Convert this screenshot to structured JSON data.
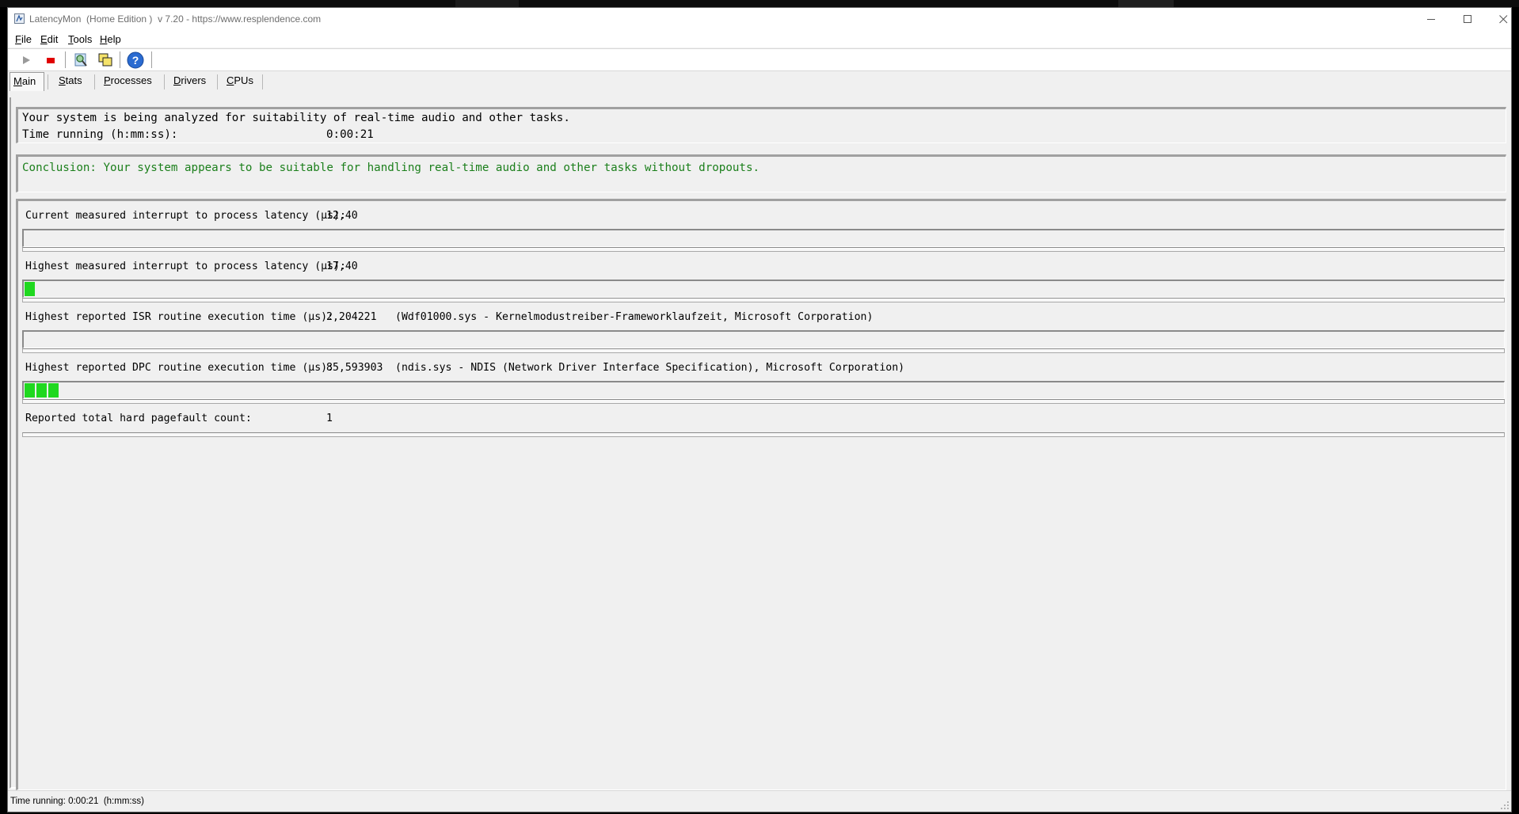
{
  "window": {
    "title": "LatencyMon  (Home Edition )  v 7.20 - https://www.resplendence.com"
  },
  "menu": {
    "file": {
      "accel": "F",
      "rest": "ile"
    },
    "edit": {
      "accel": "E",
      "rest": "dit"
    },
    "tools": {
      "accel": "T",
      "rest": "ools"
    },
    "help": {
      "accel": "H",
      "rest": "elp"
    }
  },
  "toolbar": {
    "icons": [
      "play-icon",
      "stop-icon",
      "search-drivers-icon",
      "windows-icon",
      "help-icon"
    ]
  },
  "tabs": [
    {
      "accel": "M",
      "rest": "ain"
    },
    {
      "accel": "S",
      "rest": "tats"
    },
    {
      "accel": "P",
      "rest": "rocesses"
    },
    {
      "accel": "D",
      "rest": "rivers"
    },
    {
      "accel": "C",
      "rest": "PUs"
    }
  ],
  "main": {
    "status_line": "Your system is being analyzed for suitability of real-time audio and other tasks.",
    "time_label": "Time running (h:mm:ss):",
    "time_value": "0:00:21",
    "conclusion": "Conclusion: Your system appears to be suitable for handling real-time audio and other tasks without dropouts.",
    "metrics": [
      {
        "label": "Current measured interrupt to process latency (µs):",
        "value": "12,40",
        "detail": "",
        "bar_fraction": 0.0
      },
      {
        "label": "Highest measured interrupt to process latency (µs):",
        "value": "17,40",
        "detail": "",
        "bar_fraction": 0.0085
      },
      {
        "label": "Highest reported ISR routine execution time (µs):",
        "value": "2,204221",
        "detail": "(Wdf01000.sys - Kernelmodustreiber-Frameworklaufzeit, Microsoft Corporation)",
        "bar_fraction": 0.0
      },
      {
        "label": "Highest reported DPC routine execution time (µs):",
        "value": "85,593903",
        "detail": "(ndis.sys - NDIS (Network Driver Interface Specification), Microsoft Corporation)",
        "bar_fraction": 0.025
      }
    ],
    "pagefault_label": "Reported total hard pagefault count:",
    "pagefault_value": "1"
  },
  "status_bar": {
    "text": "Time running: 0:00:21  (h:mm:ss)"
  },
  "colors": {
    "conclusion_text": "#1b7f1b",
    "bar_fill": "#1fd81f",
    "stop": "#e00000"
  }
}
